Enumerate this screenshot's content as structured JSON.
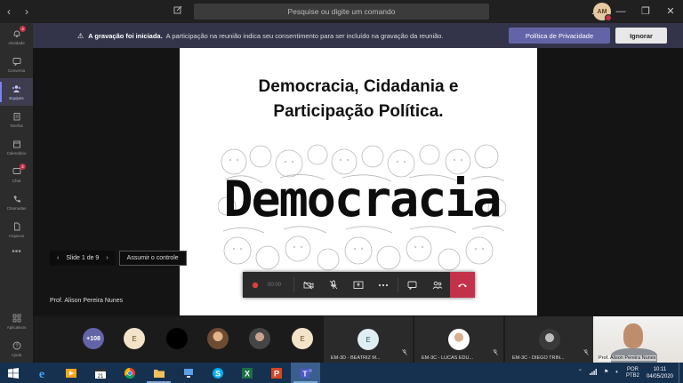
{
  "window": {
    "search_placeholder": "Pesquise ou digite um comando",
    "user_initials": "AM",
    "controls": [
      "…",
      "—",
      "❐",
      "✕"
    ]
  },
  "nav": {
    "back": "‹",
    "forward": "›"
  },
  "appbar": {
    "items": [
      {
        "label": "Atividade",
        "badge": "4"
      },
      {
        "label": "Conversa",
        "badge": ""
      },
      {
        "label": "Equipes",
        "badge": ""
      },
      {
        "label": "Tarefas",
        "badge": ""
      },
      {
        "label": "Calendário",
        "badge": ""
      },
      {
        "label": "Chat",
        "badge": "2"
      },
      {
        "label": "Chamadas",
        "badge": ""
      },
      {
        "label": "Arquivos",
        "badge": ""
      }
    ],
    "more": "•••",
    "apps_label": "Aplicativos",
    "help_label": "Ajuda",
    "active_index": 2
  },
  "banner": {
    "title": "A gravação foi iniciada.",
    "message": "A participação na reunião indica seu consentimento para ser incluído na gravação da reunião.",
    "privacy_button": "Política de Privacidade",
    "ignore_button": "Ignorar"
  },
  "slide": {
    "title_line1": "Democracia, Cidadania e",
    "title_line2": "Participação Política.",
    "image_word": "Democracia"
  },
  "slide_nav": {
    "prev": "‹",
    "counter": "Slide 1 de 9",
    "next": "›",
    "take_control": "Assumir o controle"
  },
  "presenter_name": "Prof. Alison Pereira Nunes",
  "call": {
    "timer": "00:00"
  },
  "roster": {
    "more_count": "+108",
    "initial_e": "E",
    "tiles": [
      {
        "name": "EM-3D - BEATRIZ M...",
        "initial": "E"
      },
      {
        "name": "EM-3C - LUCAS EDU...",
        "initial": ""
      },
      {
        "name": "EM-3C - DIEGO TRIN...",
        "initial": ""
      }
    ],
    "self_name": "Prof. Alison Pereira Nunes"
  },
  "taskbar": {
    "lang": "POR",
    "layout": "PTB2",
    "time": "10:11",
    "date": "04/05/2020",
    "calendar_day": "21"
  },
  "colors": {
    "accent": "#6264a7",
    "hangup": "#c4314b",
    "banner_bg": "#33344a",
    "taskbar_bg": "#16304f"
  }
}
